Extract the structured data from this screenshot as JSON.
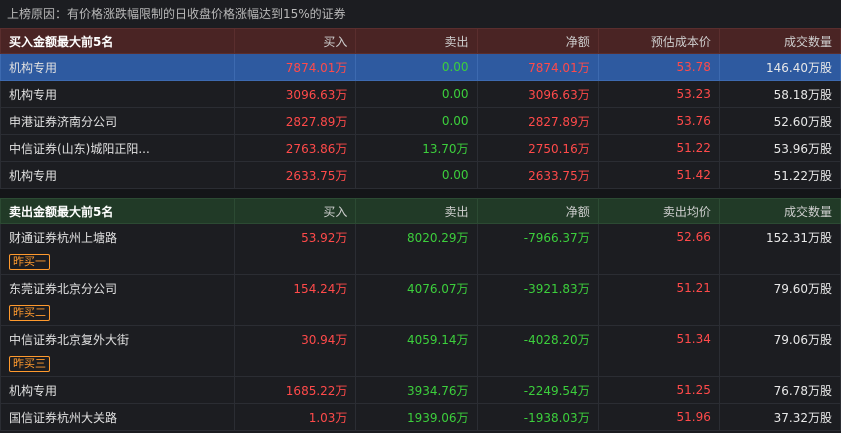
{
  "reason": "上榜原因：有价格涨跌幅限制的日收盘价格涨幅达到15%的证券",
  "buy_section": {
    "title": "买入金额最大前5名",
    "columns": [
      "买入",
      "卖出",
      "净额",
      "预估成本价",
      "成交数量"
    ],
    "rows": [
      {
        "name": "机构专用",
        "buy": "7874.01万",
        "sell": "0.00",
        "net": "7874.01万",
        "price": "53.78",
        "volume": "146.40万股"
      },
      {
        "name": "机构专用",
        "buy": "3096.63万",
        "sell": "0.00",
        "net": "3096.63万",
        "price": "53.23",
        "volume": "58.18万股"
      },
      {
        "name": "申港证券济南分公司",
        "buy": "2827.89万",
        "sell": "0.00",
        "net": "2827.89万",
        "price": "53.76",
        "volume": "52.60万股"
      },
      {
        "name": "中信证券(山东)城阳正阳...",
        "buy": "2763.86万",
        "sell": "13.70万",
        "net": "2750.16万",
        "price": "51.22",
        "volume": "53.96万股"
      },
      {
        "name": "机构专用",
        "buy": "2633.75万",
        "sell": "0.00",
        "net": "2633.75万",
        "price": "51.42",
        "volume": "51.22万股"
      }
    ]
  },
  "sell_section": {
    "title": "卖出金额最大前5名",
    "columns": [
      "买入",
      "卖出",
      "净额",
      "卖出均价",
      "成交数量"
    ],
    "rows": [
      {
        "name": "财通证券杭州上塘路",
        "buy": "53.92万",
        "sell": "8020.29万",
        "net": "-7966.37万",
        "price": "52.66",
        "volume": "152.31万股",
        "badge": "昨买一"
      },
      {
        "name": "东莞证券北京分公司",
        "buy": "154.24万",
        "sell": "4076.07万",
        "net": "-3921.83万",
        "price": "51.21",
        "volume": "79.60万股",
        "badge": "昨买二"
      },
      {
        "name": "中信证券北京复外大街",
        "buy": "30.94万",
        "sell": "4059.14万",
        "net": "-4028.20万",
        "price": "51.34",
        "volume": "79.06万股",
        "badge": "昨买三"
      },
      {
        "name": "机构专用",
        "buy": "1685.22万",
        "sell": "3934.76万",
        "net": "-2249.54万",
        "price": "51.25",
        "volume": "76.78万股",
        "badge": ""
      },
      {
        "name": "国信证券杭州大关路",
        "buy": "1.03万",
        "sell": "1939.06万",
        "net": "-1938.03万",
        "price": "51.96",
        "volume": "37.32万股",
        "badge": ""
      }
    ]
  },
  "colors": {
    "up": "#ff4a4a",
    "down": "#3ccf3c",
    "badge": "#ff9a2e",
    "selected": "#2e5aa0"
  }
}
